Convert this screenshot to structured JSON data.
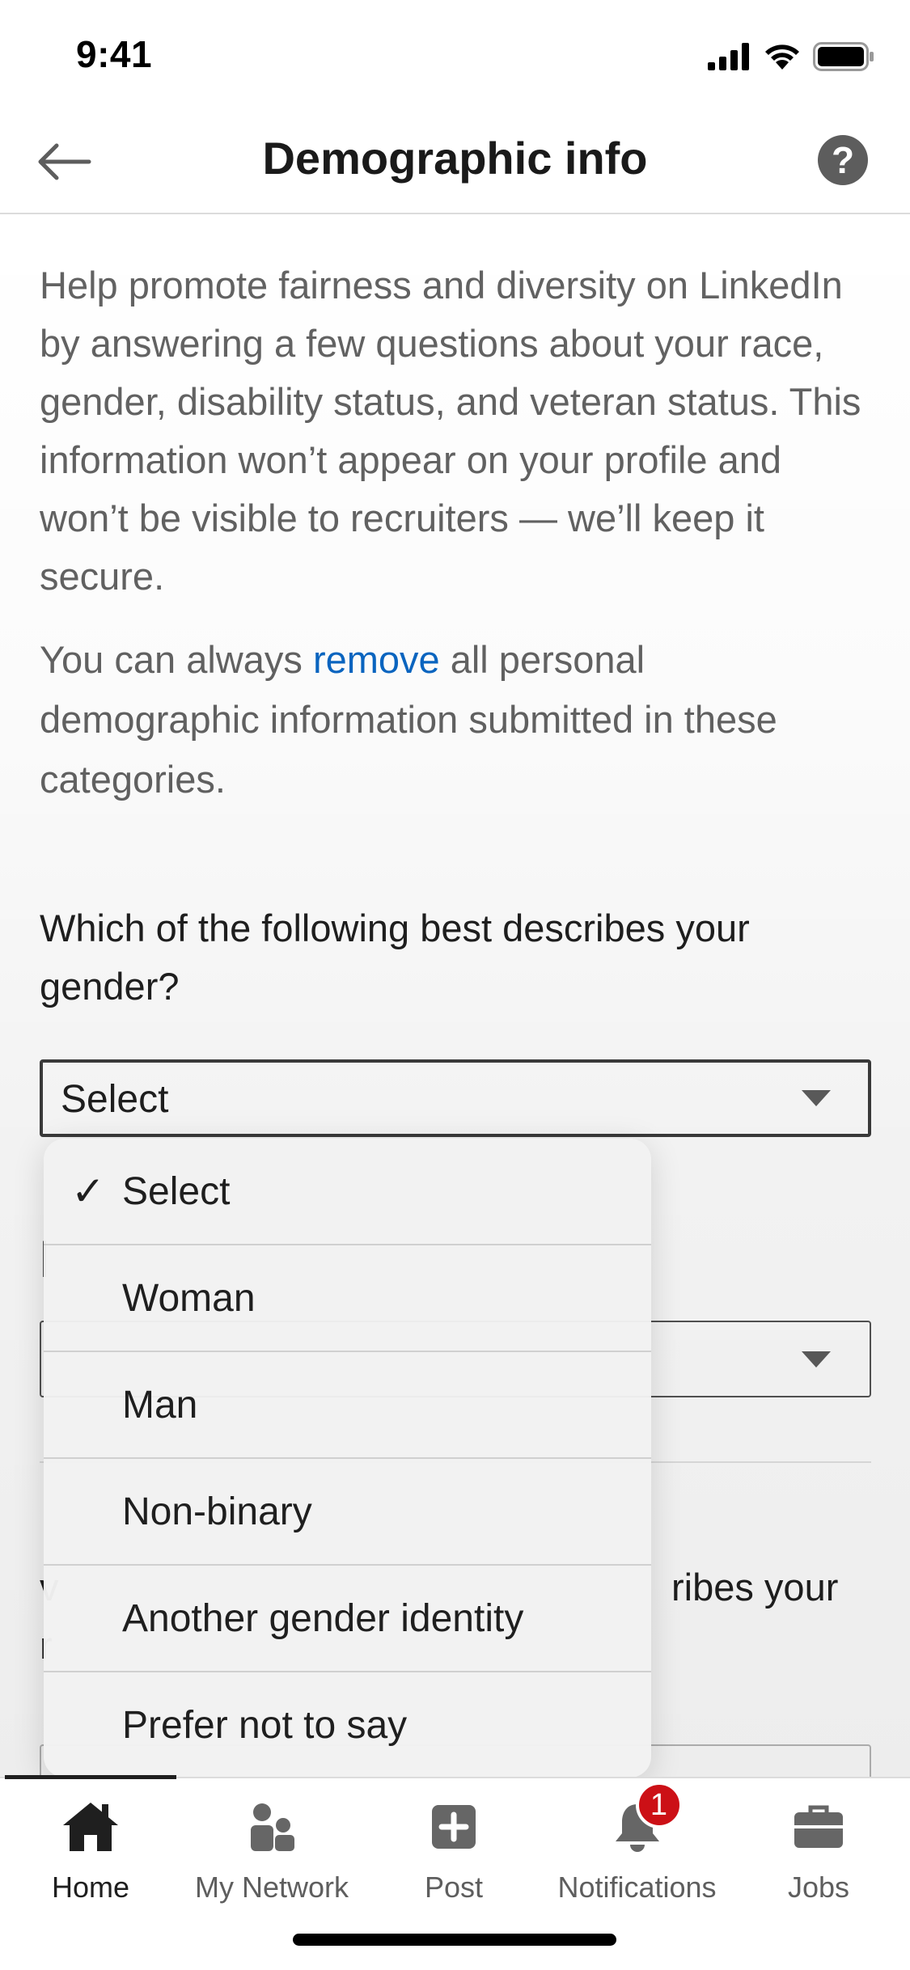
{
  "status_bar": {
    "time": "9:41"
  },
  "header": {
    "title": "Demographic info",
    "help_glyph": "?"
  },
  "intro": {
    "text": "Help promote fairness and diversity on LinkedIn by answering a few questions about your race, gender, disability status, and veteran status. This information won’t appear on your profile and won’t be visible to recruiters — we’ll keep it secure.",
    "remove_prefix": "You can always ",
    "remove_link": "remove",
    "remove_suffix": " all personal demographic information submitted in these categories."
  },
  "gender_question": {
    "label": "Which of the following best describes your gender?",
    "selected": "Select"
  },
  "partial_question": {
    "right_fragment": "ribes your"
  },
  "dropdown": {
    "check_glyph": "✓",
    "options": [
      "Select",
      "Woman",
      "Man",
      "Non-binary",
      "Another gender identity",
      "Prefer not to say"
    ],
    "selected_index": 0
  },
  "bottom_nav": {
    "items": [
      {
        "label": "Home",
        "icon": "home-icon",
        "active": true
      },
      {
        "label": "My Network",
        "icon": "people-icon",
        "active": false
      },
      {
        "label": "Post",
        "icon": "plus-square-icon",
        "active": false
      },
      {
        "label": "Notifications",
        "icon": "bell-icon",
        "active": false,
        "badge": "1"
      },
      {
        "label": "Jobs",
        "icon": "briefcase-icon",
        "active": false
      }
    ]
  },
  "colors": {
    "link": "#0a66c2",
    "badge": "#cc1016",
    "muted_text": "#626262"
  }
}
